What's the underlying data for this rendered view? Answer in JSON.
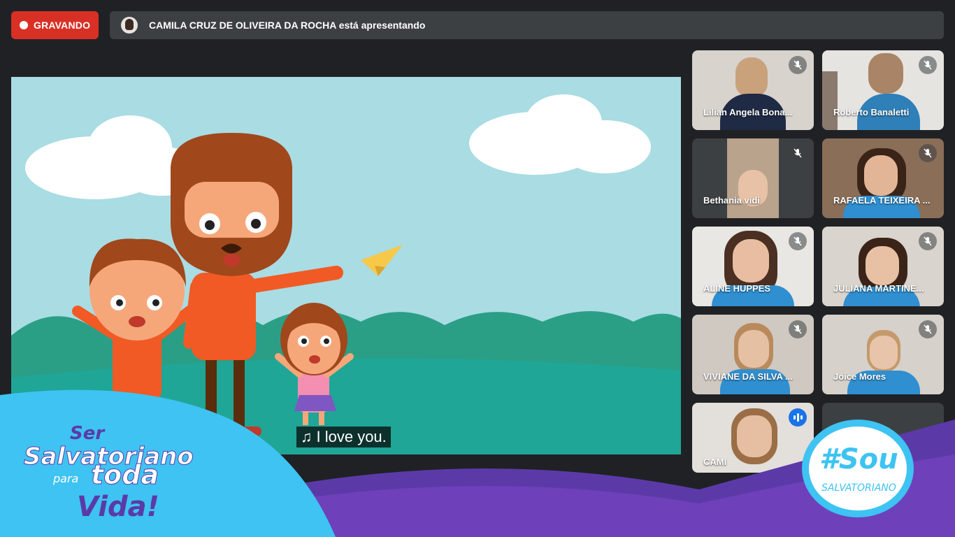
{
  "recording": {
    "label": "GRAVANDO"
  },
  "presenting": {
    "text": "CAMILA CRUZ DE OLIVEIRA DA ROCHA está apresentando"
  },
  "presentation": {
    "subtitle": "I love you.",
    "subtitle_icon": "music-note-icon"
  },
  "participants": [
    {
      "name": "Lilian Angela Bona...",
      "mic": "muted"
    },
    {
      "name": "Roberto Banaletti",
      "mic": "muted"
    },
    {
      "name": "Bethania vidi",
      "mic": "muted"
    },
    {
      "name": "RAFAELA TEIXEIRA ...",
      "mic": "muted"
    },
    {
      "name": "ALINE HUPPES",
      "mic": "muted"
    },
    {
      "name": "JULIANA MARTINE...",
      "mic": "muted"
    },
    {
      "name": "VIVIANE DA SILVA ...",
      "mic": "muted"
    },
    {
      "name": "Joice Mores",
      "mic": "muted"
    },
    {
      "name": "CAMI",
      "mic": "speaking"
    }
  ],
  "branding": {
    "left_line1": "Ser",
    "left_line2": "Salvatoriano",
    "left_line3a": "para",
    "left_line3b": "toda",
    "left_line4": "Vida!",
    "right_hashtag": "#Sou",
    "right_word": "SALVATORIANO"
  },
  "colors": {
    "record_red": "#d93025",
    "bar_gray": "#3c4043",
    "brand_blue": "#3ec3f2",
    "brand_purple": "#5b3aa8",
    "speaking_blue": "#1a73e8"
  }
}
